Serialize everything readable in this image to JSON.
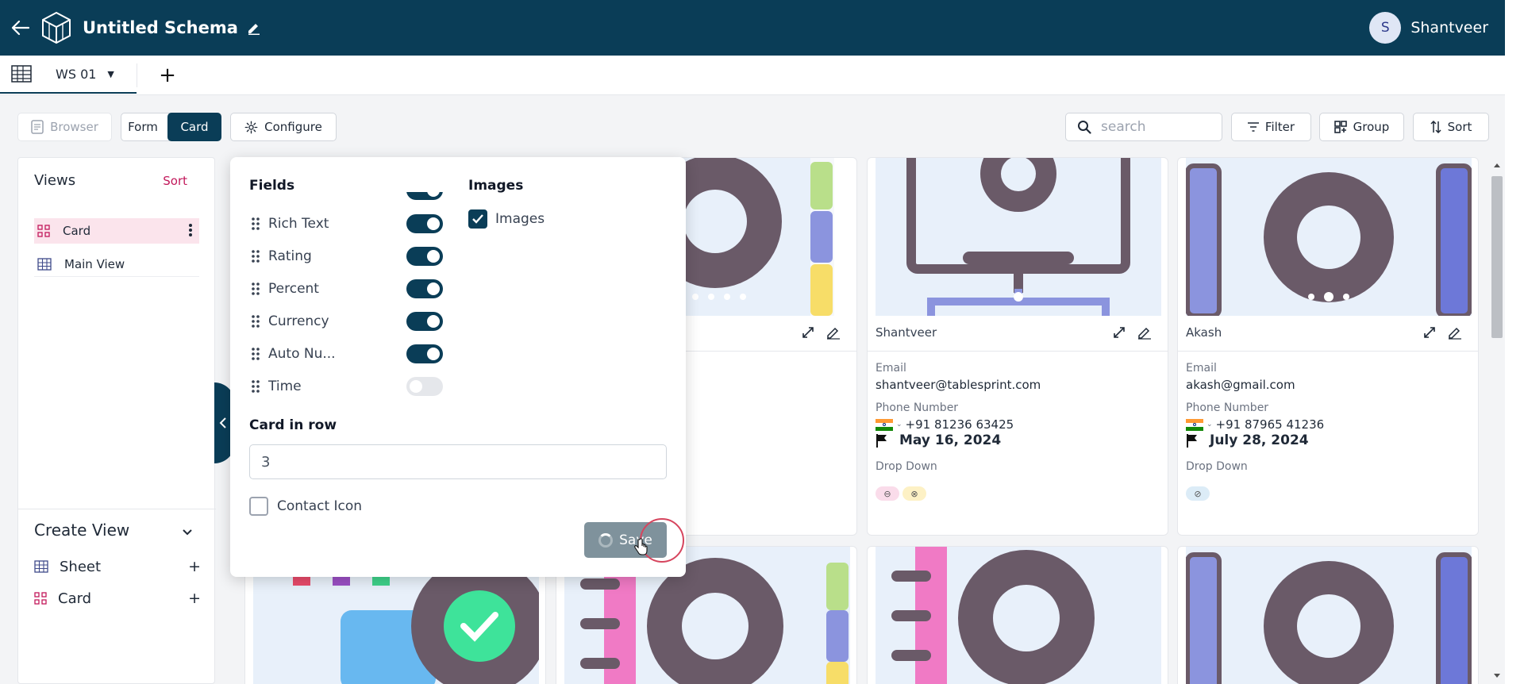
{
  "header": {
    "title": "Untitled Schema",
    "user_initial": "S",
    "user_name": "Shantveer"
  },
  "tabs": {
    "worksheet": "WS 01"
  },
  "toolbar": {
    "browser": "Browser",
    "form": "Form",
    "card": "Card",
    "configure": "Configure",
    "search_placeholder": "search",
    "filter": "Filter",
    "group": "Group",
    "sort": "Sort"
  },
  "views": {
    "title": "Views",
    "sort": "Sort",
    "items": [
      "Card",
      "Main View"
    ]
  },
  "create_view": {
    "title": "Create View",
    "items": [
      "Sheet",
      "Card"
    ]
  },
  "configure": {
    "fields_title": "Fields",
    "images_title": "Images",
    "fields": [
      {
        "label": "Rich Text",
        "enabled": true
      },
      {
        "label": "Rating",
        "enabled": true
      },
      {
        "label": "Percent",
        "enabled": true
      },
      {
        "label": "Currency",
        "enabled": true
      },
      {
        "label": "Auto Nu...",
        "enabled": true
      },
      {
        "label": "Time",
        "enabled": false
      }
    ],
    "images_option": "Images",
    "images_checked": true,
    "card_in_row_label": "Card in row",
    "card_in_row_value": "3",
    "contact_icon_label": "Contact Icon",
    "contact_icon_checked": false,
    "save": "Save"
  },
  "cards": [
    {
      "name": "Shantveer",
      "email_label": "Email",
      "email": "shantveer@tablesprint.com",
      "phone_label": "Phone Number",
      "phone": "+91 81236 63425",
      "date": "May 16, 2024",
      "dropdown_label": "Drop Down"
    },
    {
      "name": "Akash",
      "email_label": "Email",
      "email": "akash@gmail.com",
      "phone_label": "Phone Number",
      "phone": "+91 87965 41236",
      "date": "July 28, 2024",
      "dropdown_label": "Drop Down"
    }
  ],
  "colors": {
    "primary": "#0a3d57",
    "accent": "#c2185b"
  }
}
